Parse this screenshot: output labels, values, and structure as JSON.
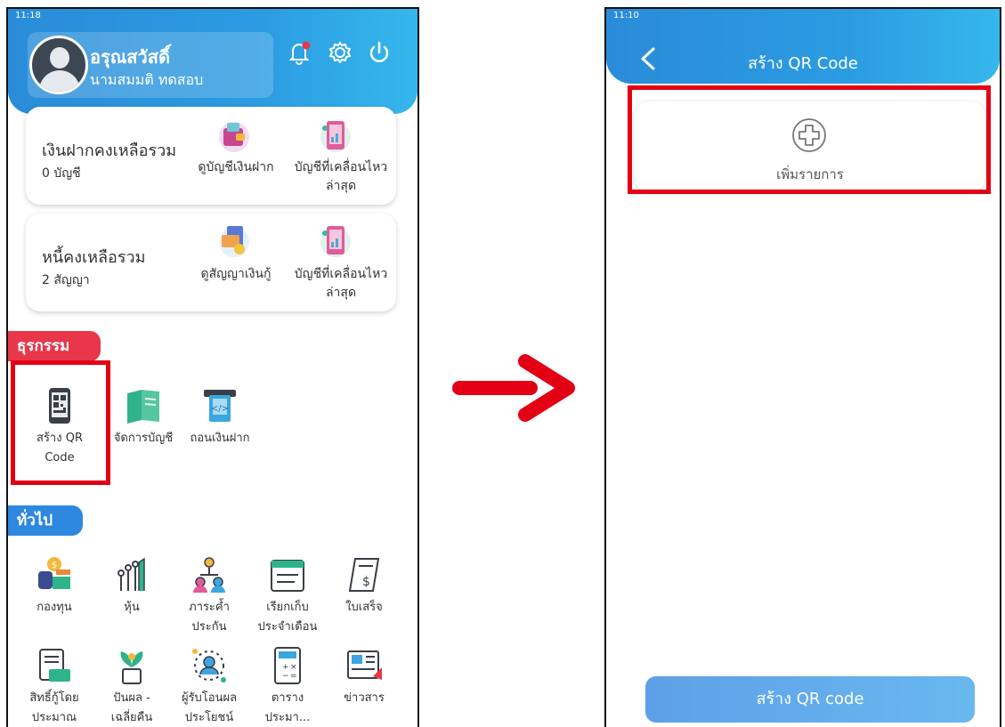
{
  "left_screen": {
    "status_time": "11:18",
    "user": {
      "name": "อรุณสวัสดิ์",
      "subtitle": "นามสมมติ ทดสอบ"
    },
    "deposit_card": {
      "title": "เงินฝากคงเหลือรวม",
      "count": "0 บัญชี",
      "action1": "ดูบัญชีเงินฝาก",
      "action2_line1": "บัญชีที่เคลื่อนไหว",
      "action2_line2": "ล่าสุด"
    },
    "loan_card": {
      "title": "หนี้คงเหลือรวม",
      "count": "2 สัญญา",
      "action1": "ดูสัญญาเงินกู้",
      "action2_line1": "บัญชีที่เคลื่อนไหว",
      "action2_line2": "ล่าสุด"
    },
    "transactions_label": "ธุรกรรม",
    "transactions": [
      {
        "line1": "สร้าง QR",
        "line2": "Code"
      },
      {
        "line1": "จัดการบัญชี",
        "line2": ""
      },
      {
        "line1": "ถอนเงินฝาก",
        "line2": ""
      }
    ],
    "general_label": "ทั่วไป",
    "general": [
      {
        "line1": "กองทุน",
        "line2": ""
      },
      {
        "line1": "หุ้น",
        "line2": ""
      },
      {
        "line1": "ภาระค้ำ",
        "line2": "ประกัน"
      },
      {
        "line1": "เรียกเก็บ",
        "line2": "ประจำเดือน"
      },
      {
        "line1": "ใบเสร็จ",
        "line2": ""
      },
      {
        "line1": "สิทธิ์กู้โดย",
        "line2": "ประมาณ"
      },
      {
        "line1": "ปันผล -",
        "line2": "เฉลี่ยคืน"
      },
      {
        "line1": "ผู้รับโอนผล",
        "line2": "ประโยชน์"
      },
      {
        "line1": "ตาราง",
        "line2": "ประมา..."
      },
      {
        "line1": "ข่าวสาร",
        "line2": ""
      }
    ]
  },
  "right_screen": {
    "status_time": "11:10",
    "title": "สร้าง QR Code",
    "add_item_label": "เพิ่มรายการ",
    "create_button": "สร้าง QR code"
  },
  "colors": {
    "header_blue": "#2b9be2",
    "transactions_tag": "#e8374a",
    "general_tag": "#2e88e0",
    "highlight": "#e40014",
    "arrow": "#e40014"
  },
  "icons": {
    "bell": "bell-icon",
    "settings": "gear-icon",
    "power": "power-icon",
    "back": "chevron-left-icon",
    "add": "plus-circle-icon"
  }
}
